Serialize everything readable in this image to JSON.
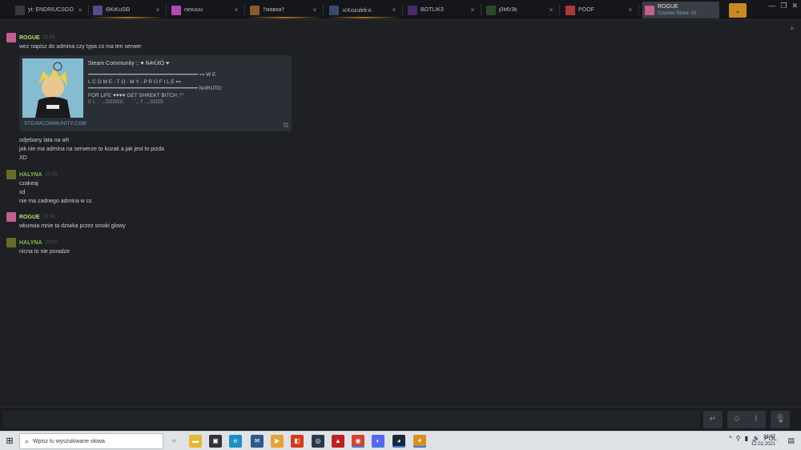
{
  "tabs": [
    {
      "label": "yt: ENDRIUCSGO",
      "color": "#3a3a3a",
      "close": "×",
      "glow": false
    },
    {
      "label": "ΘKiKuŠΘ",
      "color": "#5a4a8a",
      "close": "×",
      "glow": true
    },
    {
      "label": "nexuuu",
      "color": "#b04ab0",
      "close": "×",
      "glow": false
    },
    {
      "label": "†мавка†",
      "color": "#8a5a2a",
      "close": "×",
      "glow": true
    },
    {
      "label": "☠Kozulek☠",
      "color": "#3a4a6a",
      "close": "×",
      "glow": true
    },
    {
      "label": "BOTLIK3",
      "color": "#4a2a6a",
      "close": "×",
      "glow": false
    },
    {
      "label": "j0k€r3k",
      "color": "#2a4a2a",
      "close": "×",
      "glow": false
    },
    {
      "label": "POOF",
      "color": "#aa3a3a",
      "close": "×",
      "glow": false
    }
  ],
  "active_tab": {
    "name": "ROGUE",
    "game": "Counter-Strike: Gl",
    "color": "#c06090"
  },
  "tab_more": "⌄",
  "window_controls": [
    "—",
    "❐",
    "✕"
  ],
  "add_friend_icon": "+",
  "messages": [
    {
      "author": "ROGUE",
      "author_color": "#b8e06a",
      "avatar_color": "#c06090",
      "time": "21:55",
      "lines": [
        "wez napisz do admina czy typa co ma ten serwer"
      ]
    },
    {
      "author": "",
      "lines": [
        "odjebany lata na wh",
        "jak nie ma admina na serwerze to kozak a jak jest to pizda",
        "XD"
      ]
    },
    {
      "author": "HALYNA",
      "author_color": "#8ab84a",
      "avatar_color": "#6a6a2a",
      "time": "21:56",
      "lines": [
        "czakeaj",
        "xd",
        "nie ma zadnego admina w cs"
      ]
    },
    {
      "author": "ROGUE",
      "author_color": "#b8e06a",
      "avatar_color": "#c06090",
      "time": "21:59",
      "lines": [
        "wkurwia mnie ta dziwka przez smoki glowy"
      ]
    },
    {
      "author": "HALYNA",
      "author_color": "#8ab84a",
      "avatar_color": "#6a6a2a",
      "time": "22:00",
      "lines": [
        "nicna to nie poradze"
      ]
    }
  ],
  "embed": {
    "title": "Steam Community :: ♥ N4rÜtÖ ♥",
    "description": "━━━━━━━━━━━━━━━━━━━━━━━━━━━━━━━━━━━ ⊶ W E\nL C O M E - T O - M Y - P R O F I L E ⊷\n━━━━━━━━━━━━━━━━━━━━━━━━━━━━━━━━━━━ NARUTO\nFOR LIFE ♥♥♥♥ GET SHREKT BITCH ;⁾'⁾\n⁞⁞ ⁞.     ..⁞⁞⁞⁞⁞⁞⁞⁞⁞⁞⁞⁞.       `.. ⁞'  ...⁞⁞⁞⁞⁞⁞⁞⁞⁞",
    "domain": "STEAMCOMMUNITY.COM",
    "copy_icon": "⧉"
  },
  "input": {
    "value": "",
    "placeholder": ""
  },
  "input_buttons": [
    "↵",
    "☺",
    "⌇",
    "🎙"
  ],
  "taskbar": {
    "start_icon": "⊞",
    "search_placeholder": "Wpisz tu wyszukiwane słowa",
    "search_icon": "⌕",
    "icons": [
      {
        "name": "task-view-icon",
        "glyph": "○",
        "color": "#dfe3e8",
        "fg": "#222"
      },
      {
        "name": "file-explorer-icon",
        "glyph": "▬",
        "color": "#e8b830",
        "fg": "#fff"
      },
      {
        "name": "store-icon",
        "glyph": "▣",
        "color": "#333",
        "fg": "#fff"
      },
      {
        "name": "edge-icon",
        "glyph": "e",
        "color": "#1e8fc4",
        "fg": "#fff"
      },
      {
        "name": "mail-icon",
        "glyph": "✉",
        "color": "#2b5a8a",
        "fg": "#fff"
      },
      {
        "name": "media-icon",
        "glyph": "▶",
        "color": "#e8a030",
        "fg": "#fff"
      },
      {
        "name": "office-icon",
        "glyph": "◧",
        "color": "#d83a1a",
        "fg": "#fff"
      },
      {
        "name": "globe-icon",
        "glyph": "◎",
        "color": "#2a3a4a",
        "fg": "#fff"
      },
      {
        "name": "app-icon",
        "glyph": "▲",
        "color": "#c02020",
        "fg": "#fff"
      },
      {
        "name": "chrome-icon",
        "glyph": "◉",
        "color": "#d84030",
        "fg": "#fff"
      },
      {
        "name": "discord-icon",
        "glyph": "◐",
        "color": "#5865f2",
        "fg": "#fff"
      },
      {
        "name": "steam-icon",
        "glyph": "◕",
        "color": "#1b2838",
        "fg": "#fff"
      },
      {
        "name": "csgo-icon",
        "glyph": "✦",
        "color": "#d89020",
        "fg": "#fff"
      }
    ],
    "tray": [
      "^",
      "⚲",
      "▮",
      "🔊",
      "POL"
    ],
    "time": "22:37",
    "date": "12.02.2021",
    "notif_icon": "▤"
  }
}
